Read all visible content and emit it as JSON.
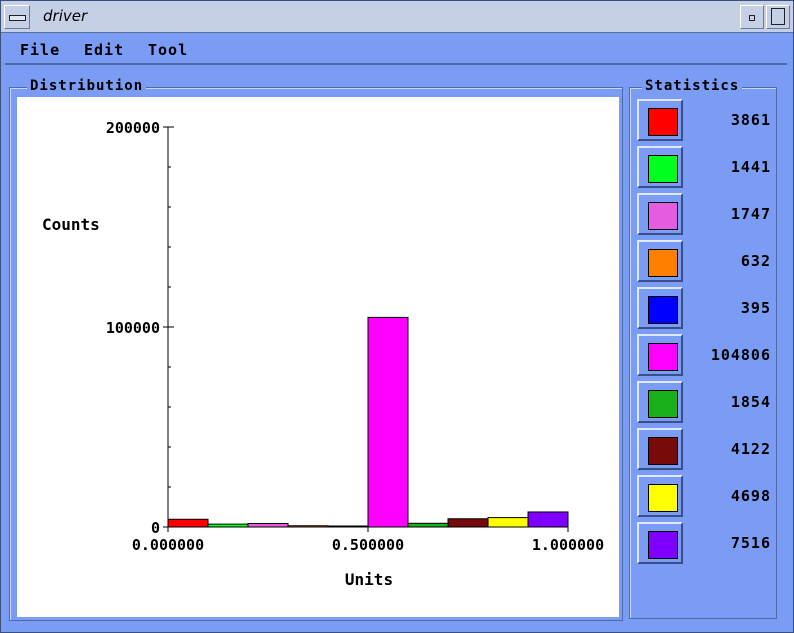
{
  "window": {
    "title": "driver"
  },
  "menu": {
    "items": [
      "File",
      "Edit",
      "Tool"
    ]
  },
  "distribution": {
    "label": "Distribution"
  },
  "statistics": {
    "label": "Statistics",
    "rows": [
      {
        "color": "#ff0000",
        "value": "3861"
      },
      {
        "color": "#00ff1e",
        "value": "1441"
      },
      {
        "color": "#e55ce0",
        "value": "1747"
      },
      {
        "color": "#ff8000",
        "value": "632"
      },
      {
        "color": "#0000ff",
        "value": "395"
      },
      {
        "color": "#ff00ff",
        "value": "104806"
      },
      {
        "color": "#19b019",
        "value": "1854"
      },
      {
        "color": "#780a0a",
        "value": "4122"
      },
      {
        "color": "#ffff00",
        "value": "4698"
      },
      {
        "color": "#7f00ff",
        "value": "7516"
      }
    ]
  },
  "chart_data": {
    "type": "bar",
    "ylabel": "Counts",
    "xlabel": "Units",
    "ylim": [
      0,
      200000
    ],
    "xlim": [
      0,
      1
    ],
    "yticks": [
      "0",
      "100000",
      "200000"
    ],
    "xticks": [
      "0.000000",
      "0.500000",
      "1.000000"
    ],
    "bins": [
      {
        "x0": 0.0,
        "x1": 0.1,
        "value": 3861,
        "color": "#ff0000"
      },
      {
        "x0": 0.1,
        "x1": 0.2,
        "value": 1441,
        "color": "#00ff1e"
      },
      {
        "x0": 0.2,
        "x1": 0.3,
        "value": 1747,
        "color": "#e55ce0"
      },
      {
        "x0": 0.3,
        "x1": 0.4,
        "value": 632,
        "color": "#ff8000"
      },
      {
        "x0": 0.4,
        "x1": 0.5,
        "value": 395,
        "color": "#0000ff"
      },
      {
        "x0": 0.5,
        "x1": 0.6,
        "value": 104806,
        "color": "#ff00ff"
      },
      {
        "x0": 0.6,
        "x1": 0.7,
        "value": 1854,
        "color": "#19b019"
      },
      {
        "x0": 0.7,
        "x1": 0.8,
        "value": 4122,
        "color": "#780a0a"
      },
      {
        "x0": 0.8,
        "x1": 0.9,
        "value": 4698,
        "color": "#ffff00"
      },
      {
        "x0": 0.9,
        "x1": 1.0,
        "value": 7516,
        "color": "#7f00ff"
      }
    ]
  }
}
